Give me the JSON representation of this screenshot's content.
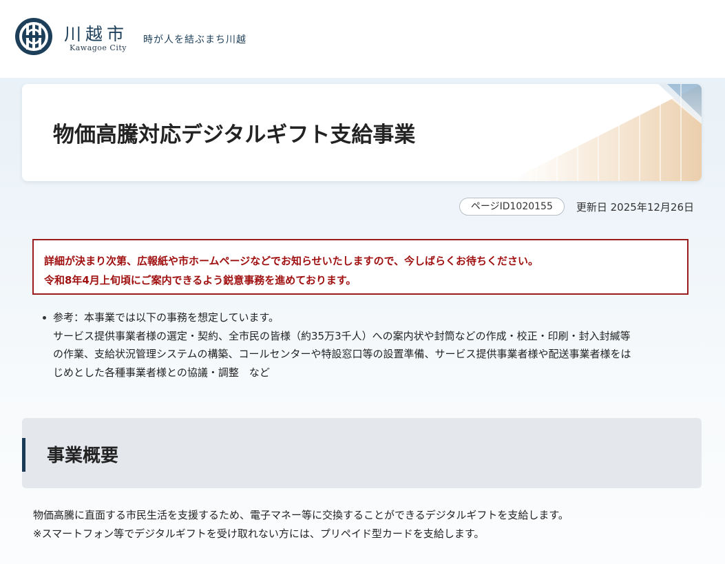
{
  "header": {
    "logo_kanji": "川越市",
    "logo_roman": "Kawagoe City",
    "tagline": "時が人を結ぶまち川越",
    "brand_color": "#1d3f5a"
  },
  "page": {
    "title": "物価高騰対応デジタルギフト支給事業",
    "page_id": "ページID1020155",
    "updated": "更新日 2025年12月26日"
  },
  "notice": {
    "line1": "詳細が決まり次第、広報紙や市ホームページなどでお知らせいたしますので、今しばらくお待ちください。",
    "line2": "令和8年4月上旬頃にご案内できるよう鋭意事務を進めております。",
    "border_color": "#9a1c1c"
  },
  "reference": {
    "lines": [
      "参考：本事業では以下の事務を想定しています。",
      "サービス提供事業者様の選定・契約、全市民の皆様（約35万3千人）への案内状や封筒などの作成・校正・印刷・封入封緘等",
      "の作業、支給状況管理システムの構築、コールセンターや特設窓口等の設置準備、サービス提供事業者様や配送事業者様をは",
      "じめとした各種事業者様との協議・調整　など"
    ]
  },
  "section": {
    "heading": "事業概要",
    "body": [
      "物価高騰に直面する市民生活を支援するため、電子マネー等に交換することができるデジタルギフトを支給します。",
      "※スマートフォン等でデジタルギフトを受け取れない方には、プリペイド型カードを支給します。"
    ]
  }
}
